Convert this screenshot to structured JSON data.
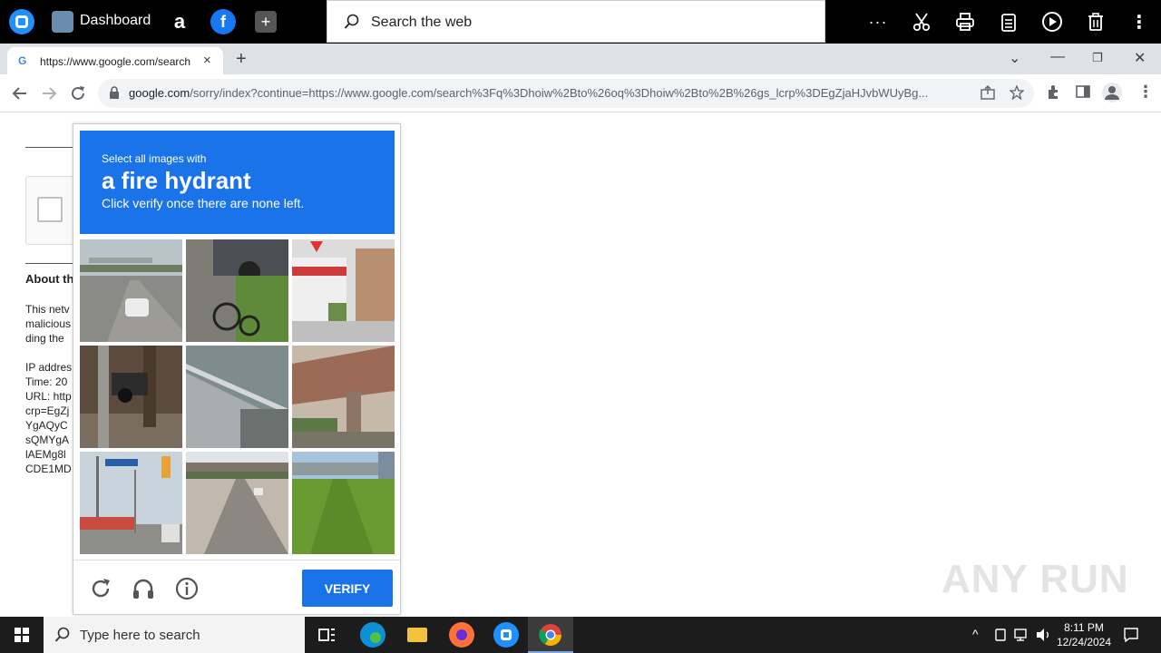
{
  "topbar": {
    "dashboard_label": "Dashboard",
    "search_placeholder": "Search the web",
    "more_label": "···"
  },
  "tab": {
    "title": "https://www.google.com/search",
    "close": "×",
    "new_tab": "+"
  },
  "window_controls": {
    "chevron": "⌄",
    "minimize": "—",
    "restore": "❐",
    "close": "✕"
  },
  "address": {
    "host": "google.com",
    "path": "/sorry/index?continue=https://www.google.com/search%3Fq%3Dhoiw%2Bto%26oq%3Dhoiw%2Bto%2B%26gs_lcrp%3DEgZjaHJvbWUyBg..."
  },
  "page": {
    "about": "About th",
    "para1": [
      "This netv",
      "malicious",
      "ding the"
    ],
    "para2": [
      "IP addres",
      "Time: 20",
      "URL: http",
      "crp=EgZj",
      "YgAQyC",
      "sQMYgA",
      "lAEMg8l",
      "CDE1MD"
    ]
  },
  "captcha": {
    "line1": "Select all images with",
    "line2": "a fire hydrant",
    "line3": "Click verify once there are none left.",
    "verify_label": "VERIFY"
  },
  "watermark": "ANY RUN",
  "taskbar": {
    "search_placeholder": "Type here to search",
    "time": "8:11 PM",
    "date": "12/24/2024"
  },
  "colors": {
    "captcha_blue": "#1a73e8",
    "topbar": "#000000",
    "taskbar": "#1c1c1c"
  }
}
